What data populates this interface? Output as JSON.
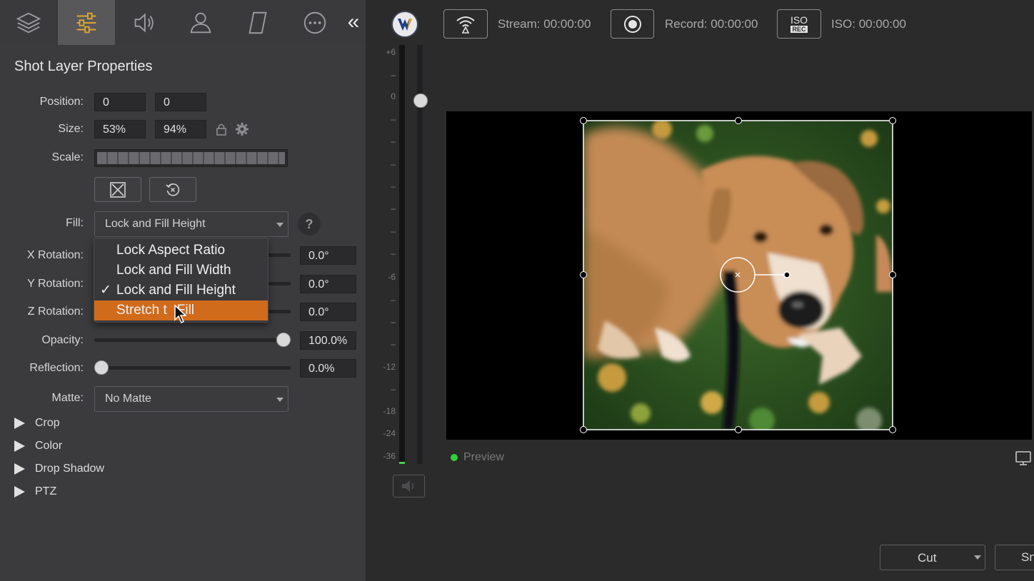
{
  "toolbar": {
    "tabs": [
      {
        "icon": "layers-icon"
      },
      {
        "icon": "sliders-icon",
        "active": true
      },
      {
        "icon": "speaker-icon"
      },
      {
        "icon": "person-icon"
      },
      {
        "icon": "parallelogram-icon"
      },
      {
        "icon": "more-icon"
      }
    ],
    "collapse_label": "«"
  },
  "panel": {
    "title": "Shot Layer Properties",
    "position": {
      "label": "Position:",
      "x": "0",
      "y": "0"
    },
    "size": {
      "label": "Size:",
      "w": "53%",
      "h": "94%"
    },
    "scale": {
      "label": "Scale:"
    },
    "fill": {
      "label": "Fill:",
      "value": "Lock and Fill Height",
      "help": "?",
      "options": [
        "Lock Aspect Ratio",
        "Lock and Fill Width",
        "Lock and Fill Height",
        "Stretch to Fill"
      ],
      "checked_index": 2,
      "highlighted_index": 3,
      "highlighted_display": "Stretch t",
      "highlighted_display_tail": "Fill",
      "checkmark": "✓"
    },
    "x_rotation": {
      "label": "X Rotation:",
      "value": "0.0°"
    },
    "y_rotation": {
      "label": "Y Rotation:",
      "value": "0.0°"
    },
    "z_rotation": {
      "label": "Z Rotation:",
      "value": "0.0°"
    },
    "opacity": {
      "label": "Opacity:",
      "value": "100.0%",
      "level": 1.0
    },
    "reflection": {
      "label": "Reflection:",
      "value": "0.0%",
      "level": 0.0
    },
    "matte": {
      "label": "Matte:",
      "value": "No Matte"
    },
    "sections": [
      "Crop",
      "Color",
      "Drop Shadow",
      "PTZ"
    ]
  },
  "meter": {
    "labels": [
      "+6",
      "0",
      "-6",
      "-12",
      "-18",
      "-24",
      "-36"
    ]
  },
  "status": {
    "stream": "Stream:  00:00:00",
    "record": "Record:  00:00:00",
    "iso_badge_top": "ISO",
    "iso_badge_bottom": "REC",
    "iso": "ISO:  00:00:00"
  },
  "preview": {
    "label": "Preview"
  },
  "transition": {
    "value": "Cut",
    "next_button": "Sn"
  },
  "colors": {
    "accent": "#d06b1c",
    "live_dot": "#2fd23a"
  }
}
